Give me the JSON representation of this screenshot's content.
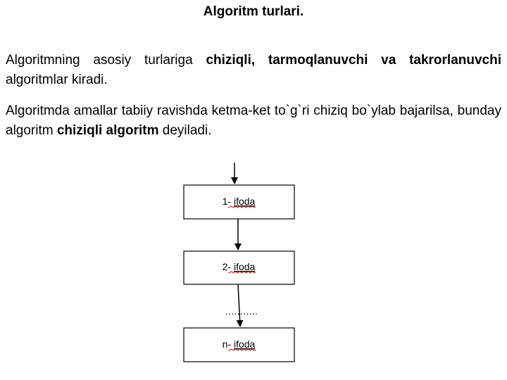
{
  "title": "Algoritm turlari.",
  "paragraph1": {
    "text_a": "Algoritmning asosiy turlariga ",
    "bold_a": "chiziqli, tarmoqlanuvchi va takrorlanuvchi",
    "text_b": " algoritmlar kiradi."
  },
  "paragraph2": {
    "text_a": "Algoritmda amallar tabiiy ravishda ketma-ket to`g`ri chiziq bo`ylab bajarilsa, bunday algoritm ",
    "bold_a": "chiziqli algoritm",
    "text_b": " deyiladi."
  },
  "flowchart": {
    "boxes": [
      {
        "prefix": "1- ",
        "word": "ifoda"
      },
      {
        "prefix": "2- ",
        "word": "ifoda"
      },
      {
        "prefix": "n- ",
        "word": "ifoda"
      }
    ],
    "ellipsis": "..........."
  }
}
